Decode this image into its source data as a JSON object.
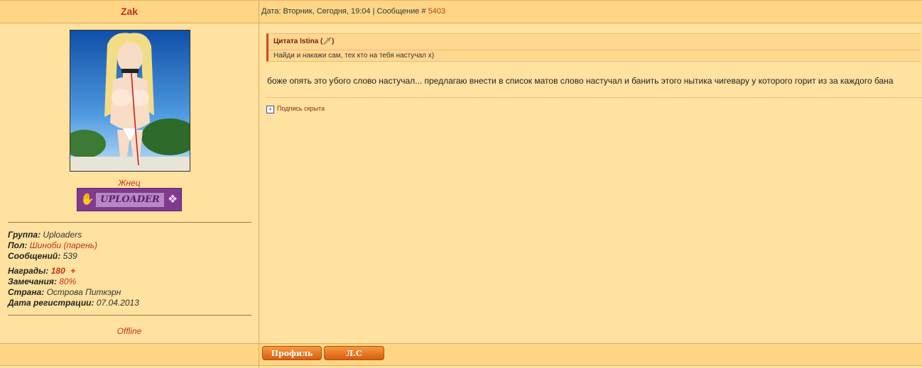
{
  "author": {
    "name": "Zak"
  },
  "meta": {
    "text": "Дата: Вторник, Сегодня, 19:04 | Сообщение # ",
    "number": "5403"
  },
  "profile": {
    "rank": "Жнец",
    "rank_badge": "UPLOADER",
    "fields": {
      "group_label": "Группа:",
      "group_value": " Uploaders",
      "gender_label": "Пол:",
      "gender_value": " Шиноби (парень)",
      "posts_label": "Сообщений:",
      "posts_value": " 539",
      "awards_label": "Награды:",
      "awards_value": " 180",
      "awards_plus": "+",
      "warnings_label": "Замечания:",
      "warnings_value": " 80%",
      "country_label": "Страна:",
      "country_value": " Острова Питкэрн",
      "regdate_label": "Дата регистрации:",
      "regdate_value": " 07.04.2013"
    },
    "status": "Offline"
  },
  "quote": {
    "prefix": "Цитата Istina (",
    "suffix": ")",
    "text": "Найди и накажи сам, тех кто на тебя настучал x)"
  },
  "message": "боже опять это убого слово настучал... предлагаю внести в список матов слово настучал и банить этого нытика чигевару у которого горит из за каждого бана",
  "signature": {
    "label": "Подпись скрыта"
  },
  "buttons": {
    "profile": "Профиль",
    "pm": "Л.С"
  }
}
